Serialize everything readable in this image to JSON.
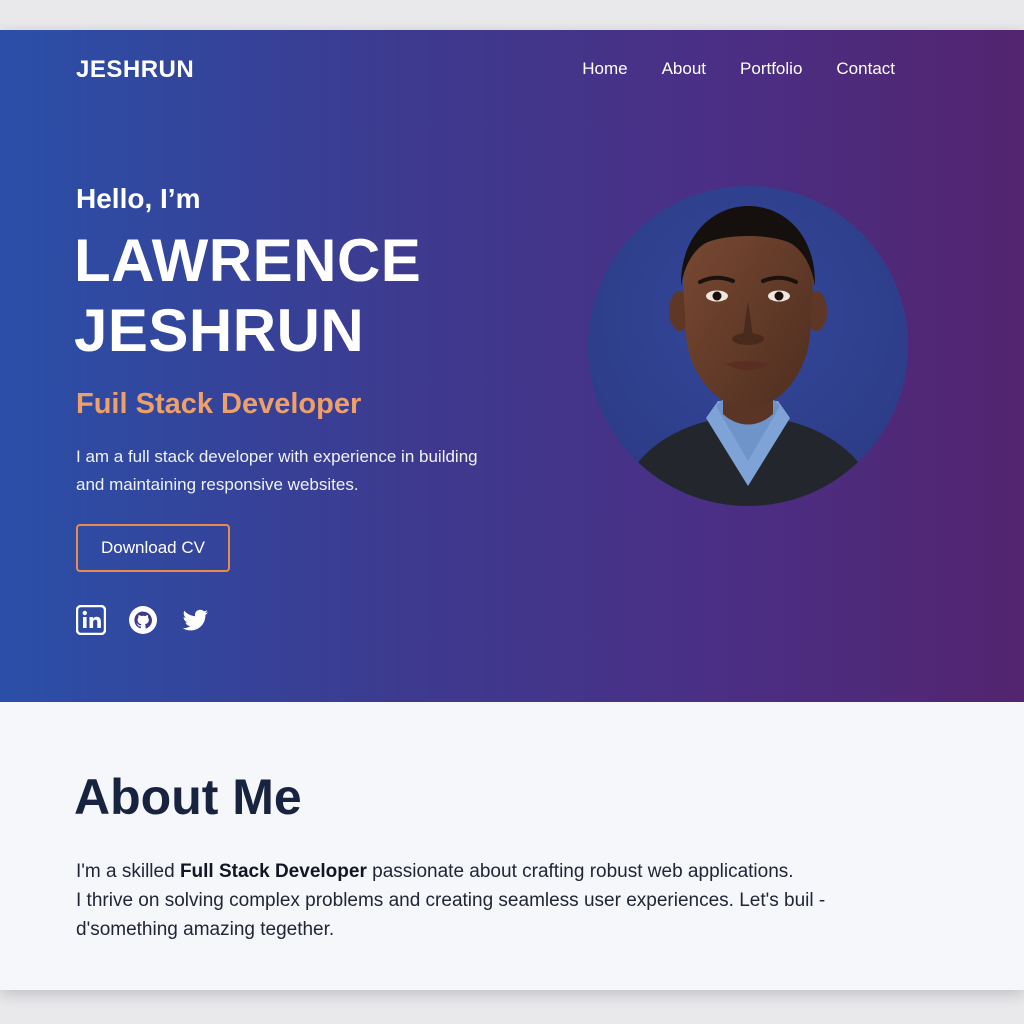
{
  "brand": "JESHRUN",
  "nav": {
    "items": [
      "Home",
      "About",
      "Portfolio",
      "Contact"
    ]
  },
  "hero": {
    "greeting": "Hello, I’m",
    "name_line1": "LAWRENCE",
    "name_line2": "JESHRUN",
    "role": "Fuil Stack Developer",
    "intro_line1": "I am a full stack developer with experience in building",
    "intro_line2": "and maintaining responsive websites.",
    "cta_label": "Download CV",
    "socials": [
      "linkedin-icon",
      "github-icon",
      "twitter-icon"
    ]
  },
  "about": {
    "title": "About Me",
    "text_prefix": "I'm a skilled ",
    "text_bold": "Full Stack Developer",
    "text_line1_rest": " passionate about crafting robust web applications.",
    "text_line2": "I thrive on solving complex problems and creating seamless user experiences. Let's buil -",
    "text_line3": "d'something amazing tegether."
  },
  "colors": {
    "gradient_start": "#2b4fa8",
    "gradient_end": "#53246f",
    "accent": "#eda06a",
    "button_border": "#e98a4e",
    "heading_dark": "#18233f"
  }
}
